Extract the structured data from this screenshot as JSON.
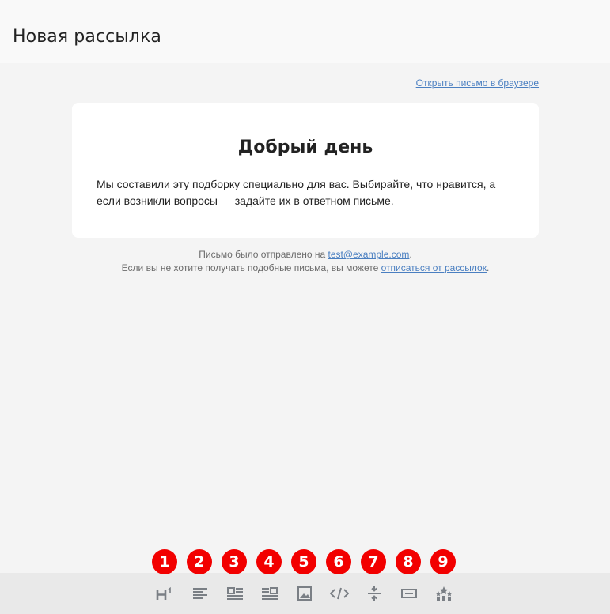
{
  "header": {
    "title": "Новая рассылка"
  },
  "email": {
    "browser_link": "Открыть письмо в браузере",
    "heading": "Добрый день",
    "body_text": "Мы составили эту подборку специально для вас. Выбирайте, что нравится, а если возникли вопросы — задайте их в ответном письме."
  },
  "footer": {
    "sent_prefix": "Письмо было отправлено на ",
    "email": "test@example.com",
    "sent_suffix": ".",
    "unsub_prefix": "Если вы не хотите получать подобные письма, вы можете ",
    "unsub_link": "отписаться от рассылок",
    "unsub_suffix": "."
  },
  "toolbar": {
    "items": [
      {
        "badge": "1",
        "icon": "heading-icon"
      },
      {
        "badge": "2",
        "icon": "text-align-left-icon"
      },
      {
        "badge": "3",
        "icon": "image-left-text-icon"
      },
      {
        "badge": "4",
        "icon": "image-right-text-icon"
      },
      {
        "badge": "5",
        "icon": "image-icon"
      },
      {
        "badge": "6",
        "icon": "code-icon"
      },
      {
        "badge": "7",
        "icon": "spacer-icon"
      },
      {
        "badge": "8",
        "icon": "button-icon"
      },
      {
        "badge": "9",
        "icon": "social-icon"
      }
    ]
  },
  "colors": {
    "accent_link": "#4a7fc1",
    "badge": "#f20000",
    "icon": "#7a7f85",
    "background": "#f4f4f4"
  }
}
